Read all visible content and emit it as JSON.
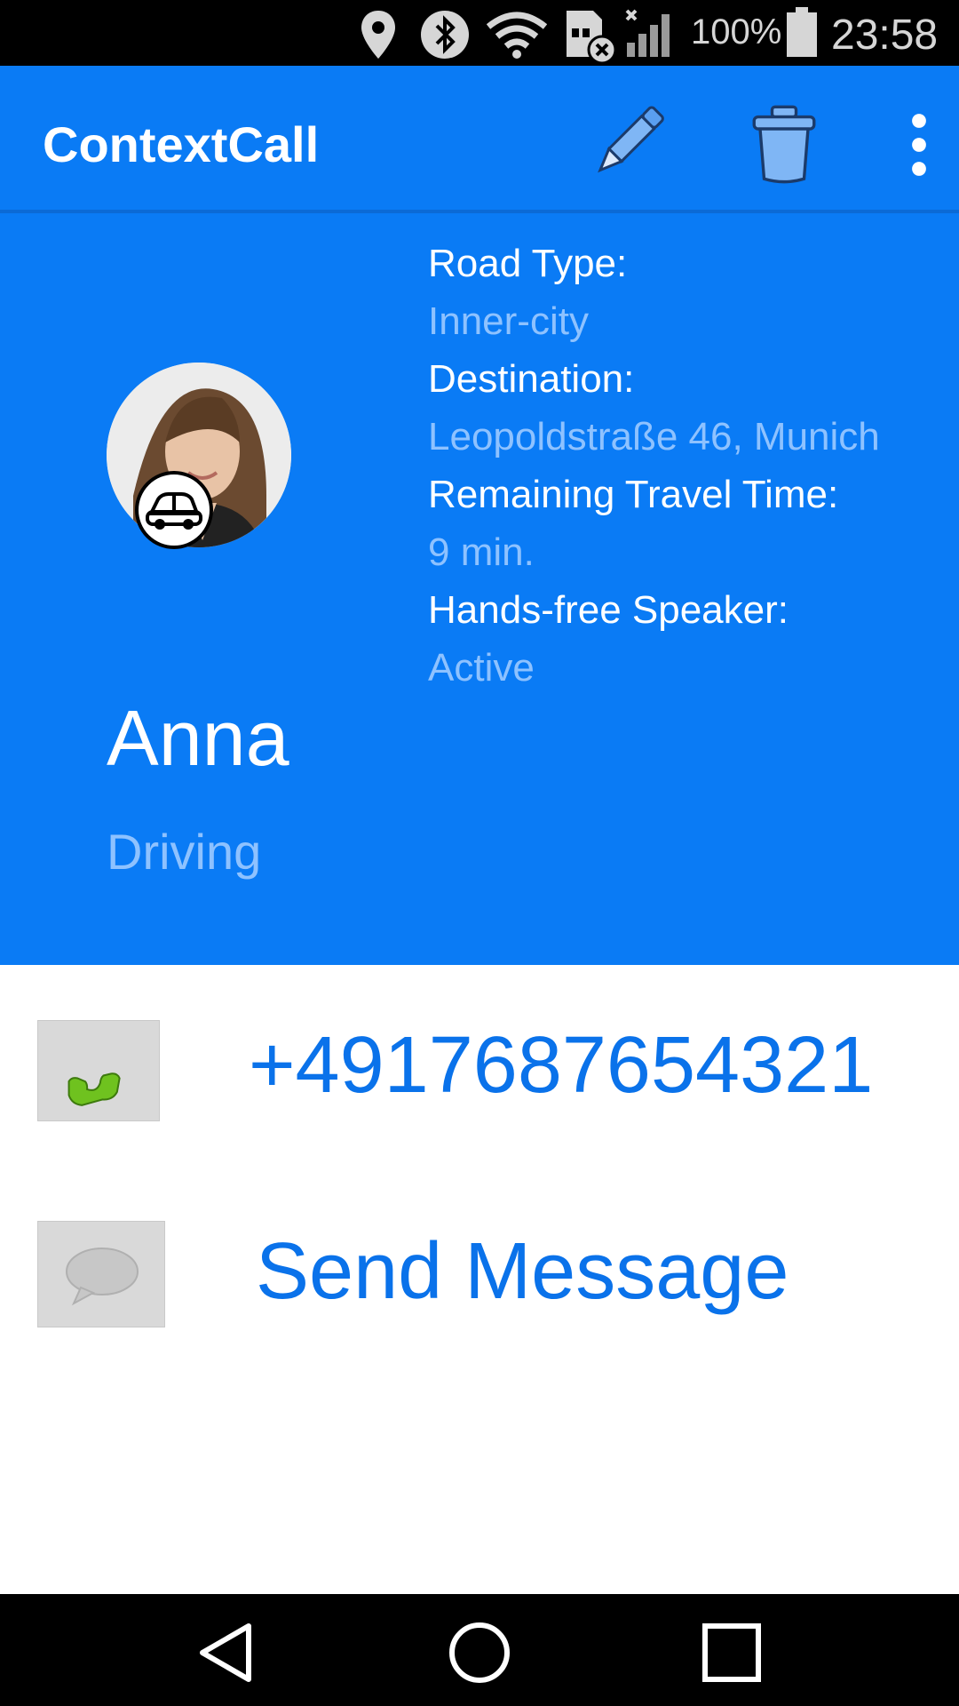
{
  "status_bar": {
    "icons": [
      "location-icon",
      "bluetooth-icon",
      "wifi-icon",
      "sim-error-icon",
      "signal-icon",
      "battery-icon"
    ],
    "battery_percent": "100%",
    "time": "23:58"
  },
  "app_bar": {
    "title": "ContextCall",
    "actions": [
      "edit-icon",
      "delete-icon",
      "overflow-menu-icon"
    ]
  },
  "contact": {
    "name": "Anna",
    "status": "Driving",
    "status_badge_icon": "car-icon"
  },
  "context": [
    {
      "label": "Road Type:",
      "value": "Inner-city"
    },
    {
      "label": "Destination:",
      "value": "Leopoldstraße 46, Munich"
    },
    {
      "label": "Remaining Travel Time:",
      "value": "9 min."
    },
    {
      "label": "Hands-free Speaker:",
      "value": "Active"
    }
  ],
  "actions": {
    "call": {
      "icon": "phone-icon",
      "label": "+4917687654321"
    },
    "message": {
      "icon": "speech-bubble-icon",
      "label": "Send Message"
    }
  },
  "colors": {
    "primary": "#0a7bf5",
    "secondary_text": "#8ec2ff",
    "link": "#0a72ea"
  },
  "nav_bar": [
    "back-icon",
    "home-icon",
    "recents-icon"
  ]
}
